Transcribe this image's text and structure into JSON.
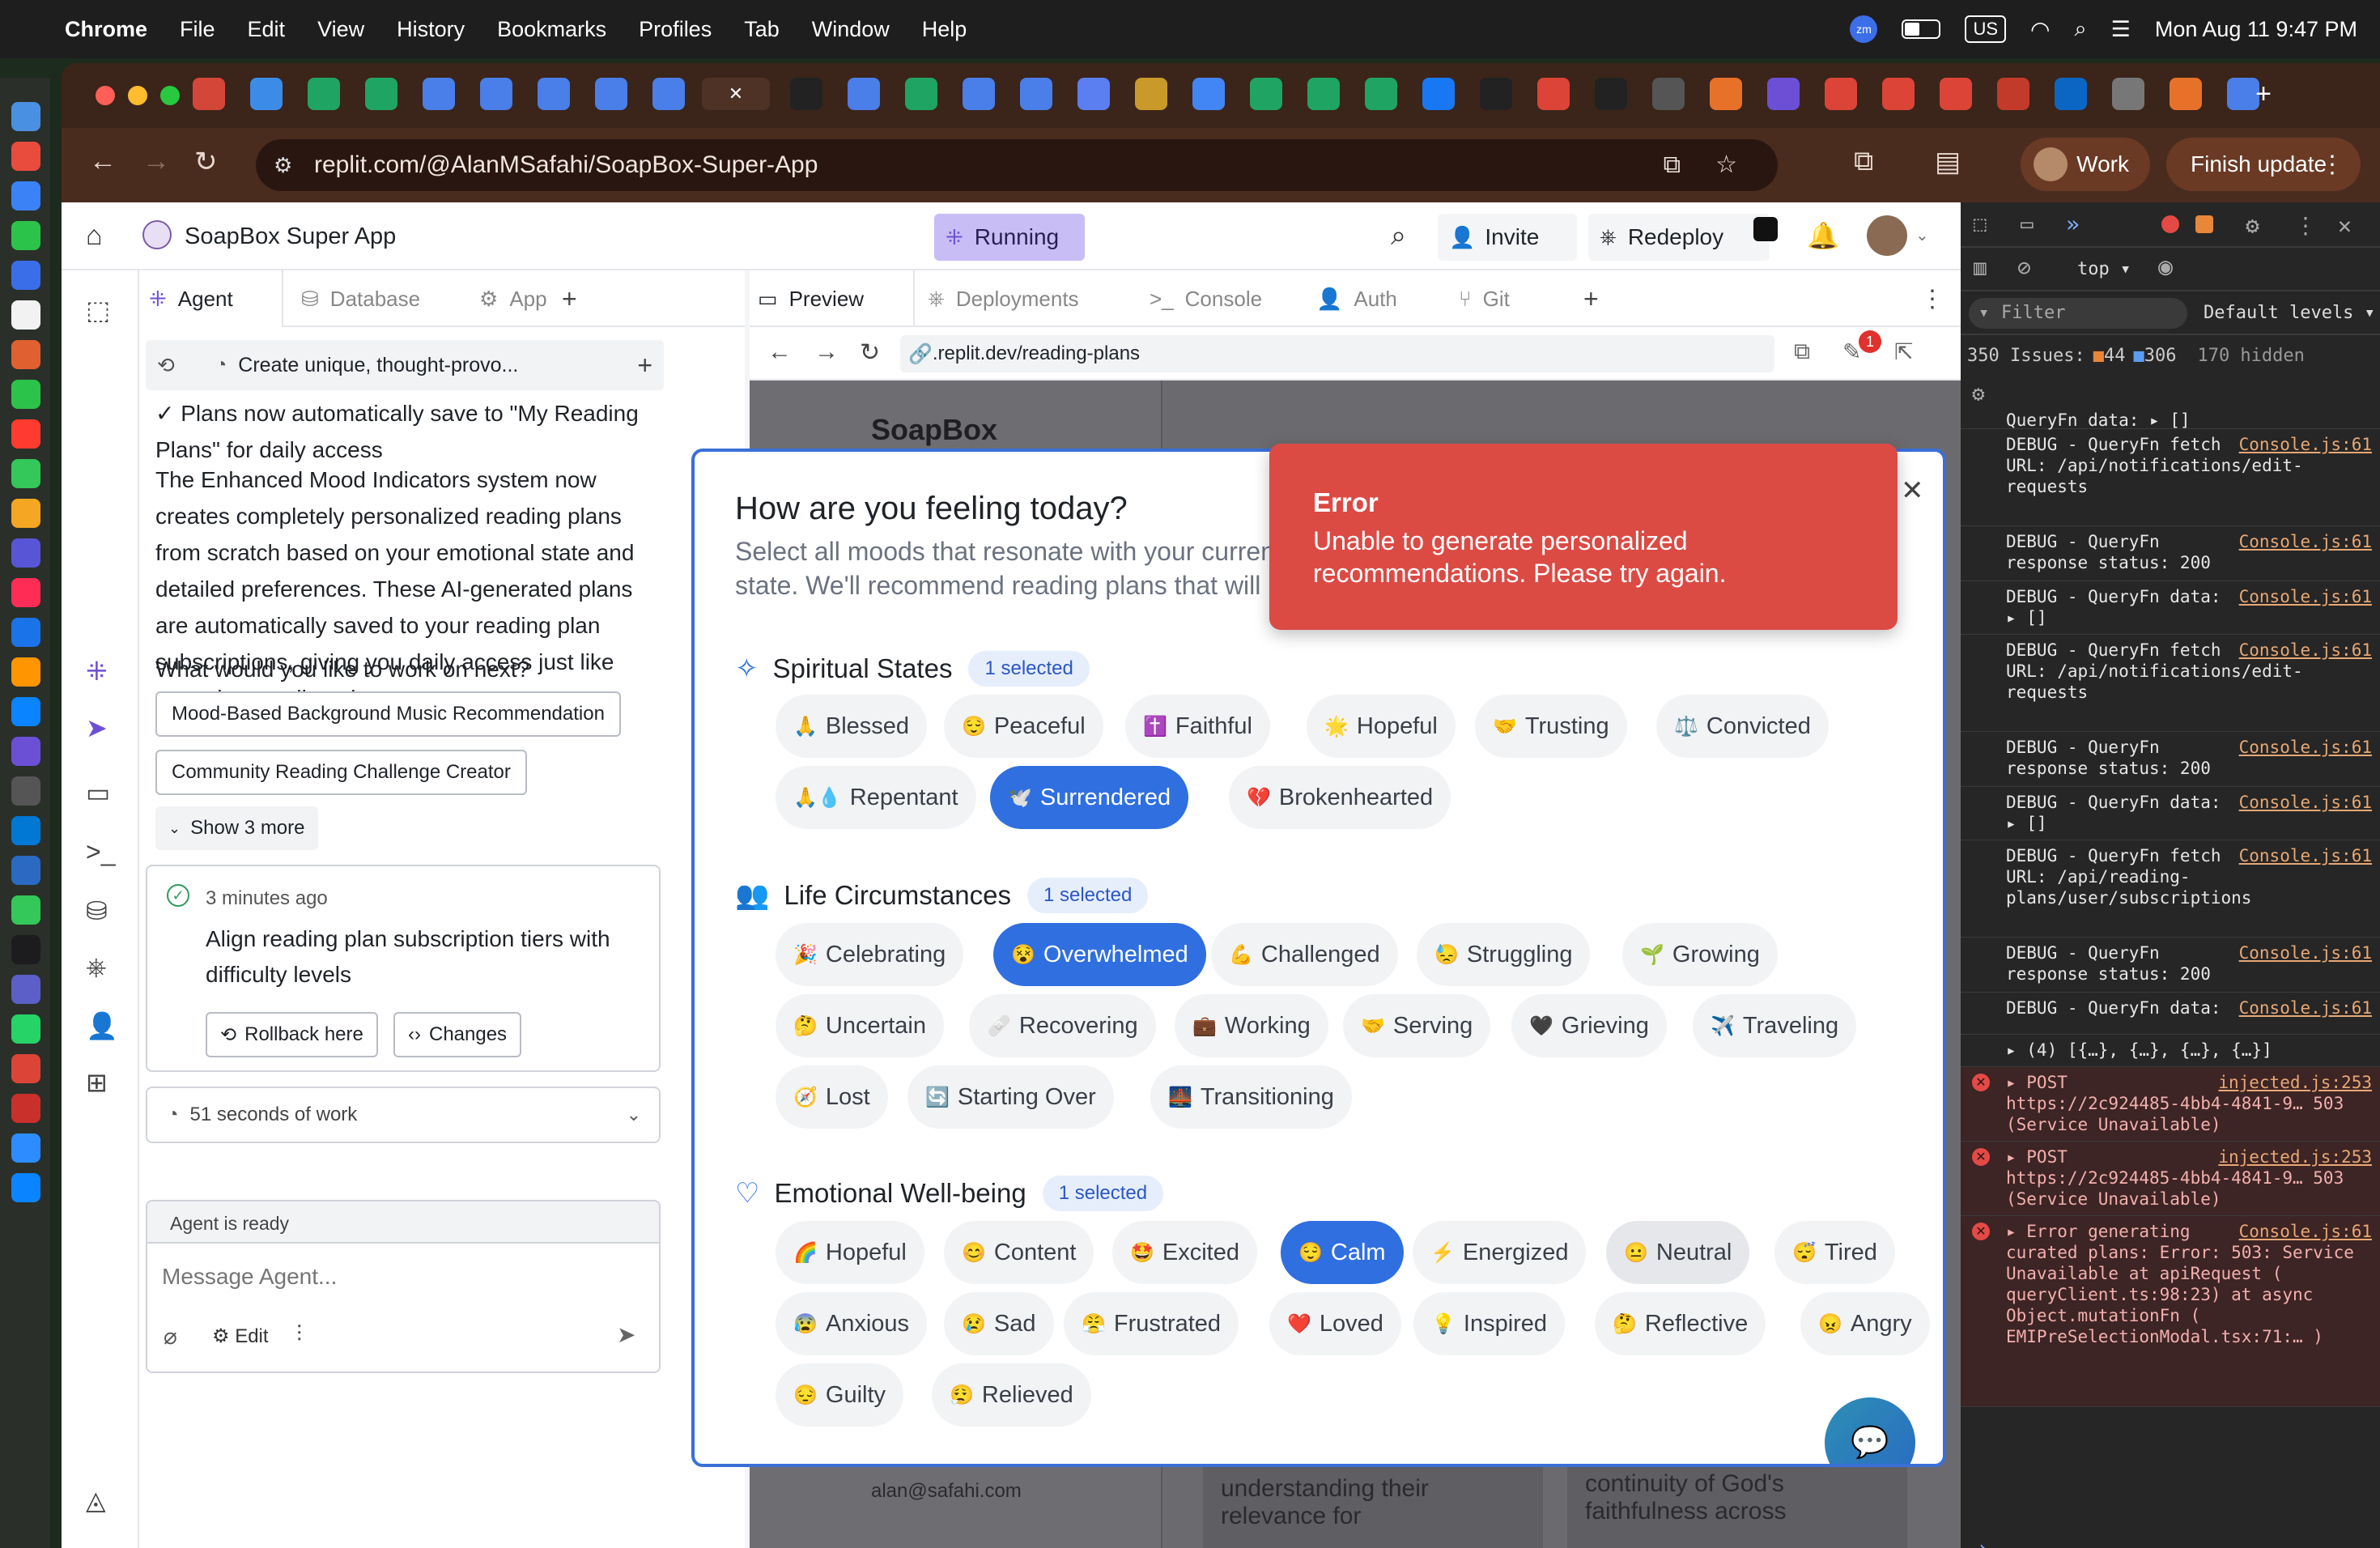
{
  "menubar": {
    "app": "Chrome",
    "items": [
      "File",
      "Edit",
      "View",
      "History",
      "Bookmarks",
      "Profiles",
      "Tab",
      "Window",
      "Help"
    ],
    "input_source": "US",
    "datetime": "Mon Aug 11  9:47 PM"
  },
  "browser": {
    "url": "replit.com/@AlanMSafahi/SoapBox-Super-App",
    "profile_label": "Work",
    "finish_update": "Finish update"
  },
  "replit": {
    "project_name": "SoapBox Super App",
    "status": "Running",
    "invite": "Invite",
    "redeploy": "Redeploy",
    "left_tabs": [
      "Agent",
      "Database",
      "App"
    ],
    "right_tabs": [
      "Preview",
      "Deployments",
      "Console",
      "Auth",
      "Git"
    ],
    "task_title": "Create unique, thought-provo...",
    "preview_url": ".replit.dev/reading-plans",
    "notification_count": "1"
  },
  "agent": {
    "line1": "✓ Plans now automatically save to \"My Reading Plans\" for daily access",
    "paragraph": "The Enhanced Mood Indicators system now creates completely personalized reading plans from scratch based on your emotional state and detailed preferences. These AI-generated plans are automatically saved to your reading plan subscriptions, giving you daily access just like any other reading plan.",
    "question": "What would you like to work on next?",
    "suggestions": [
      "Mood-Based Background Music Recommendation",
      "Community Reading Challenge Creator"
    ],
    "show_more": "Show 3 more",
    "checkpoint_time": "3 minutes ago",
    "checkpoint_text": "Align reading plan subscription tiers with difficulty levels",
    "rollback": "Rollback here",
    "changes": "Changes",
    "work_time": "51 seconds of work",
    "status": "Agent is ready",
    "placeholder": "Message Agent...",
    "edit": "Edit"
  },
  "app_bg": {
    "brand": "SoapBox",
    "email": "alan@safahi.com",
    "card1": "understanding their relevance for",
    "card2": "continuity of God's faithfulness across"
  },
  "modal": {
    "title": "How are you feeling today?",
    "subtitle": "Select all moods that resonate with your current state. We'll recommend reading plans that will meet you e",
    "sections": [
      {
        "title": "Spiritual States",
        "badge": "1 selected",
        "moods": [
          {
            "emoji": "🙏",
            "label": "Blessed"
          },
          {
            "emoji": "😌",
            "label": "Peaceful"
          },
          {
            "emoji": "✝️",
            "label": "Faithful"
          },
          {
            "emoji": "🌟",
            "label": "Hopeful"
          },
          {
            "emoji": "🤝",
            "label": "Trusting"
          },
          {
            "emoji": "⚖️",
            "label": "Convicted"
          },
          {
            "emoji": "🙏💧",
            "label": "Repentant"
          },
          {
            "emoji": "🕊️",
            "label": "Surrendered"
          },
          {
            "emoji": "💔",
            "label": "Brokenhearted"
          }
        ]
      },
      {
        "title": "Life Circumstances",
        "badge": "1 selected",
        "moods": [
          {
            "emoji": "🎉",
            "label": "Celebrating"
          },
          {
            "emoji": "😵",
            "label": "Overwhelmed"
          },
          {
            "emoji": "💪",
            "label": "Challenged"
          },
          {
            "emoji": "😓",
            "label": "Struggling"
          },
          {
            "emoji": "🌱",
            "label": "Growing"
          },
          {
            "emoji": "🤔",
            "label": "Uncertain"
          },
          {
            "emoji": "🩹",
            "label": "Recovering"
          },
          {
            "emoji": "💼",
            "label": "Working"
          },
          {
            "emoji": "🤝",
            "label": "Serving"
          },
          {
            "emoji": "🖤",
            "label": "Grieving"
          },
          {
            "emoji": "✈️",
            "label": "Traveling"
          },
          {
            "emoji": "🧭",
            "label": "Lost"
          },
          {
            "emoji": "🔄",
            "label": "Starting Over"
          },
          {
            "emoji": "🌉",
            "label": "Transitioning"
          }
        ]
      },
      {
        "title": "Emotional Well-being",
        "badge": "1 selected",
        "moods": [
          {
            "emoji": "🌈",
            "label": "Hopeful"
          },
          {
            "emoji": "😊",
            "label": "Content"
          },
          {
            "emoji": "🤩",
            "label": "Excited"
          },
          {
            "emoji": "😌",
            "label": "Calm"
          },
          {
            "emoji": "⚡",
            "label": "Energized"
          },
          {
            "emoji": "😐",
            "label": "Neutral"
          },
          {
            "emoji": "😴",
            "label": "Tired"
          },
          {
            "emoji": "😰",
            "label": "Anxious"
          },
          {
            "emoji": "😢",
            "label": "Sad"
          },
          {
            "emoji": "😤",
            "label": "Frustrated"
          },
          {
            "emoji": "❤️",
            "label": "Loved"
          },
          {
            "emoji": "💡",
            "label": "Inspired"
          },
          {
            "emoji": "🤔",
            "label": "Reflective"
          },
          {
            "emoji": "😠",
            "label": "Angry"
          },
          {
            "emoji": "😔",
            "label": "Guilty"
          },
          {
            "emoji": "😮‍💨",
            "label": "Relieved"
          }
        ]
      }
    ],
    "selected": [
      "Surrendered",
      "Overwhelmed",
      "Calm"
    ]
  },
  "toast": {
    "title": "Error",
    "message": "Unable to generate personalized recommendations. Please try again."
  },
  "devtools": {
    "context": "top",
    "filter": "Filter",
    "levels": "Default levels",
    "issues": "350 Issues:",
    "warn_count": "44",
    "info_count": "306",
    "hidden": "170 hidden",
    "log": [
      {
        "type": "debug",
        "text": "QueryFn data:  ▸ []",
        "src": ""
      },
      {
        "type": "debug",
        "text": "DEBUG - QueryFn fetch URL: /api/notifications/edit-requests",
        "src": "Console.js:61"
      },
      {
        "type": "debug",
        "text": "DEBUG - QueryFn response status: 200",
        "src": "Console.js:61"
      },
      {
        "type": "debug",
        "text": "DEBUG - QueryFn data:  ▸ []",
        "src": "Console.js:61"
      },
      {
        "type": "debug",
        "text": "DEBUG - QueryFn fetch URL: /api/notifications/edit-requests",
        "src": "Console.js:61"
      },
      {
        "type": "debug",
        "text": "DEBUG - QueryFn response status: 200",
        "src": "Console.js:61"
      },
      {
        "type": "debug",
        "text": "DEBUG - QueryFn data:  ▸ []",
        "src": "Console.js:61"
      },
      {
        "type": "debug",
        "text": "DEBUG - QueryFn fetch URL: /api/reading-plans/user/subscriptions",
        "src": "Console.js:61"
      },
      {
        "type": "debug",
        "text": "DEBUG - QueryFn response status: 200",
        "src": "Console.js:61"
      },
      {
        "type": "debug",
        "text": "DEBUG - QueryFn data:",
        "src": "Console.js:61"
      },
      {
        "type": "debug",
        "text": "▸ (4) [{…}, {…}, {…}, {…}]",
        "src": ""
      },
      {
        "type": "error",
        "text": "▸ POST https://2c924485-4bb4-4841-9… 503 (Service Unavailable)",
        "src": "injected.js:253"
      },
      {
        "type": "error",
        "text": "▸ POST https://2c924485-4bb4-4841-9… 503 (Service Unavailable)",
        "src": "injected.js:253"
      },
      {
        "type": "error",
        "text": "▸ Error generating curated plans: Error: 503: Service Unavailable at apiRequest ( queryClient.ts:98:23) at async Object.mutationFn ( EMIPreSelectionModal.tsx:71:… )",
        "src": "Console.js:61"
      }
    ]
  }
}
